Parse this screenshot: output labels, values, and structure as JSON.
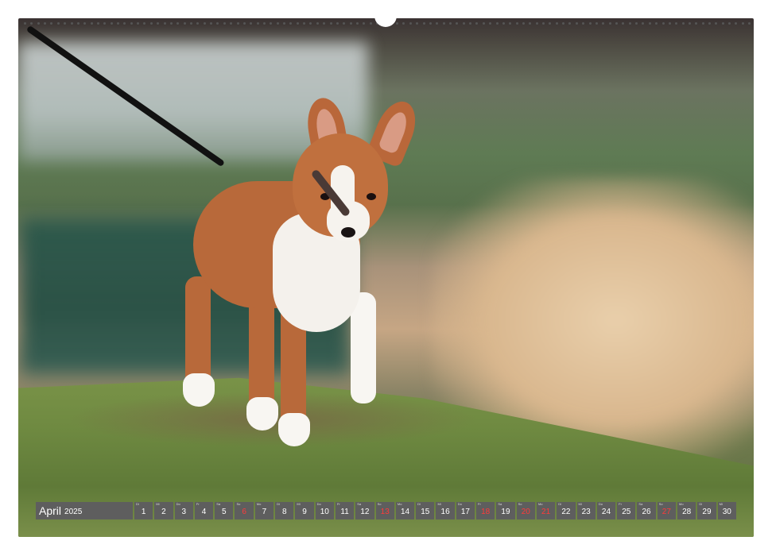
{
  "calendar": {
    "month": "April",
    "year": "2025",
    "days": [
      {
        "num": "1",
        "name": "Di",
        "sunday": false
      },
      {
        "num": "2",
        "name": "Mi",
        "sunday": false
      },
      {
        "num": "3",
        "name": "Do",
        "sunday": false
      },
      {
        "num": "4",
        "name": "Fr",
        "sunday": false
      },
      {
        "num": "5",
        "name": "Sa",
        "sunday": false
      },
      {
        "num": "6",
        "name": "So",
        "sunday": true
      },
      {
        "num": "7",
        "name": "Mo",
        "sunday": false
      },
      {
        "num": "8",
        "name": "Di",
        "sunday": false
      },
      {
        "num": "9",
        "name": "Mi",
        "sunday": false
      },
      {
        "num": "10",
        "name": "Do",
        "sunday": false
      },
      {
        "num": "11",
        "name": "Fr",
        "sunday": false
      },
      {
        "num": "12",
        "name": "Sa",
        "sunday": false
      },
      {
        "num": "13",
        "name": "So",
        "sunday": true
      },
      {
        "num": "14",
        "name": "Mo",
        "sunday": false
      },
      {
        "num": "15",
        "name": "Di",
        "sunday": false
      },
      {
        "num": "16",
        "name": "Mi",
        "sunday": false
      },
      {
        "num": "17",
        "name": "Do",
        "sunday": false
      },
      {
        "num": "18",
        "name": "Fr",
        "sunday": true
      },
      {
        "num": "19",
        "name": "Sa",
        "sunday": false
      },
      {
        "num": "20",
        "name": "So",
        "sunday": true
      },
      {
        "num": "21",
        "name": "Mo",
        "sunday": true
      },
      {
        "num": "22",
        "name": "Di",
        "sunday": false
      },
      {
        "num": "23",
        "name": "Mi",
        "sunday": false
      },
      {
        "num": "24",
        "name": "Do",
        "sunday": false
      },
      {
        "num": "25",
        "name": "Fr",
        "sunday": false
      },
      {
        "num": "26",
        "name": "Sa",
        "sunday": false
      },
      {
        "num": "27",
        "name": "So",
        "sunday": true
      },
      {
        "num": "28",
        "name": "Mo",
        "sunday": false
      },
      {
        "num": "29",
        "name": "Di",
        "sunday": false
      },
      {
        "num": "30",
        "name": "Mi",
        "sunday": false
      }
    ]
  },
  "colors": {
    "strip": "#5e5e5e",
    "holiday": "#ff3a3a"
  }
}
